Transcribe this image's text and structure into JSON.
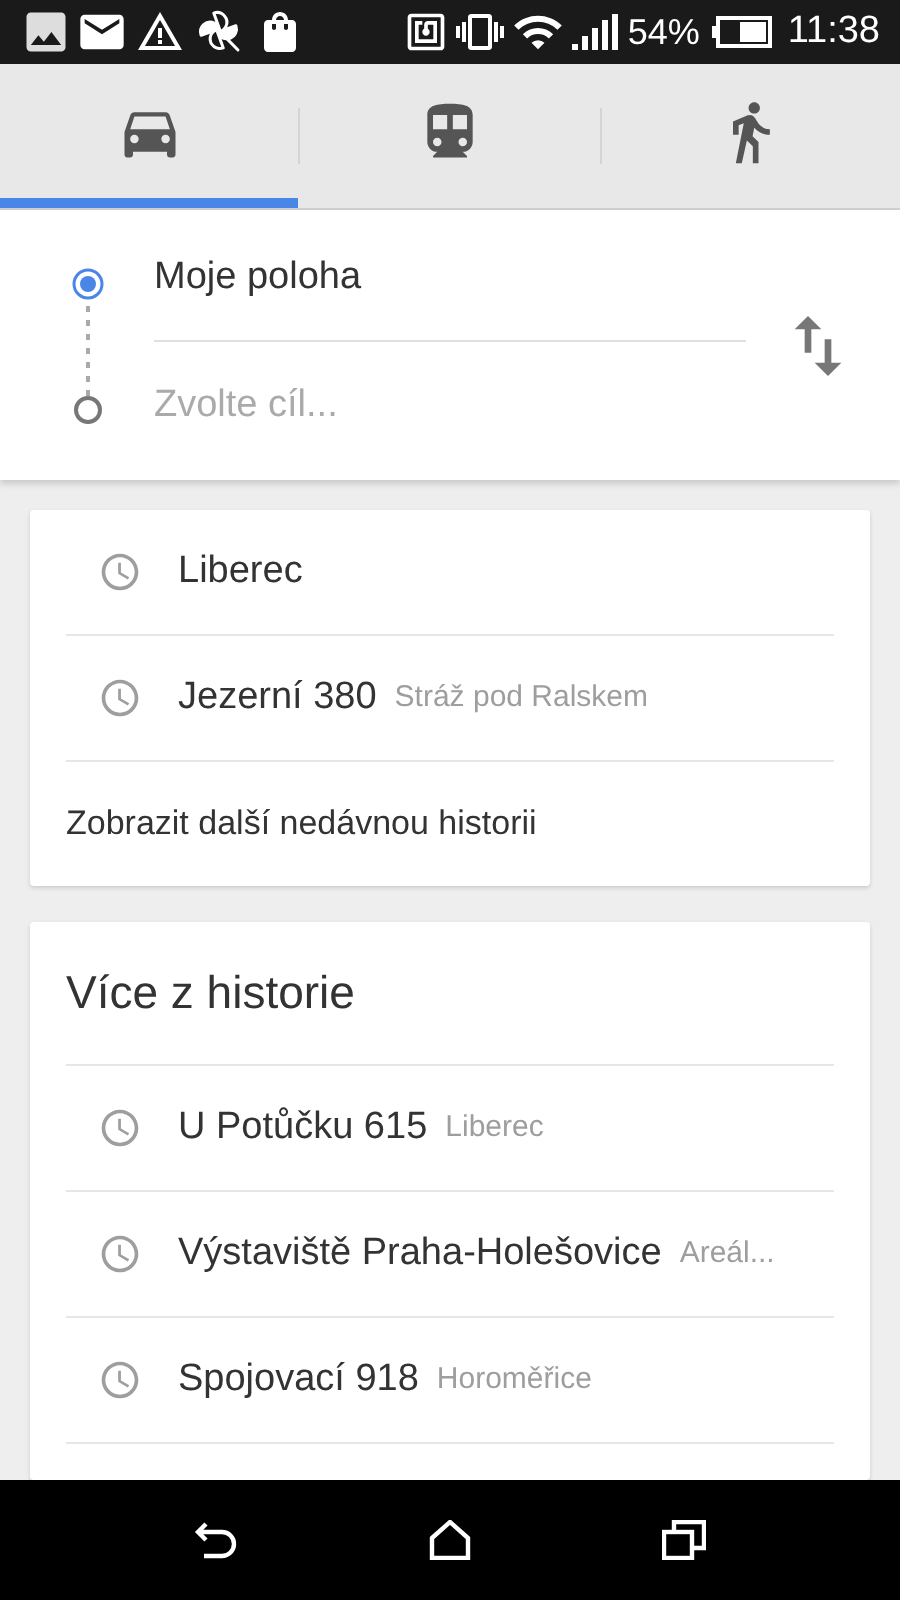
{
  "status_bar": {
    "battery": "54%",
    "time": "11:38"
  },
  "tabs": [
    {
      "kind": "car",
      "selected": true
    },
    {
      "kind": "transit",
      "selected": false
    },
    {
      "kind": "walk",
      "selected": false
    }
  ],
  "route": {
    "origin": "Moje poloha",
    "destination": {
      "placeholder": "Zvolte cíl..."
    }
  },
  "recent": {
    "items": [
      {
        "title": "Liberec"
      },
      {
        "title": "Jezerní 380",
        "subtitle": "Stráž pod Ralskem"
      }
    ],
    "more_link": "Zobrazit další nedávnou historii"
  },
  "more_history": {
    "title": "Více z historie",
    "items": [
      {
        "title": "U Potůčku 615",
        "subtitle": "Liberec"
      },
      {
        "title": "Výstaviště Praha-Holešovice",
        "subtitle": "Areál..."
      },
      {
        "title": "Spojovací 918",
        "subtitle": "Horoměřice"
      }
    ]
  }
}
